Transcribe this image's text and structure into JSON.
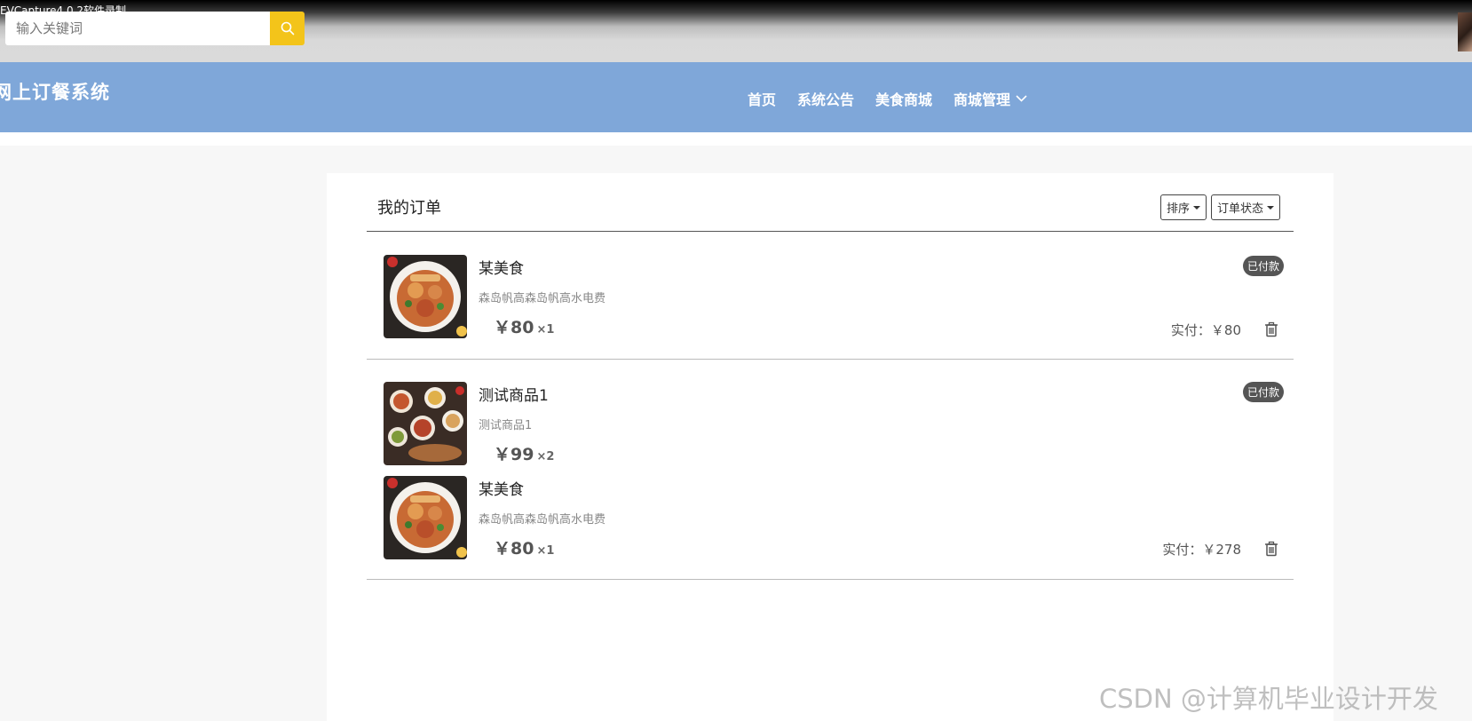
{
  "recorder_label": "EVCapture4.0.2软件录制",
  "search": {
    "placeholder": "输入关键词"
  },
  "brand": "网上订餐系统",
  "nav": {
    "items": [
      {
        "label": "首页"
      },
      {
        "label": "系统公告"
      },
      {
        "label": "美食商城"
      },
      {
        "label": "商城管理",
        "has_dropdown": true
      }
    ]
  },
  "orders_page": {
    "title": "我的订单",
    "sort_label": "排序",
    "status_filter_label": "订单状态",
    "orders": [
      {
        "status": "已付款",
        "paid_label": "实付：￥80",
        "items": [
          {
            "name": "某美食",
            "desc": "森岛帆高森岛帆高水电费",
            "price": "￥80",
            "qty": "×1"
          }
        ]
      },
      {
        "status": "已付款",
        "paid_label": "实付：￥278",
        "items": [
          {
            "name": "测试商品1",
            "desc": "测试商品1",
            "price": "￥99",
            "qty": "×2"
          },
          {
            "name": "某美食",
            "desc": "森岛帆高森岛帆高水电费",
            "price": "￥80",
            "qty": "×1"
          }
        ]
      }
    ]
  },
  "colors": {
    "nav_bg": "#7fa7d9",
    "search_button": "#f3c41a",
    "badge_bg": "#555555"
  },
  "watermark": "CSDN @计算机毕业设计开发"
}
